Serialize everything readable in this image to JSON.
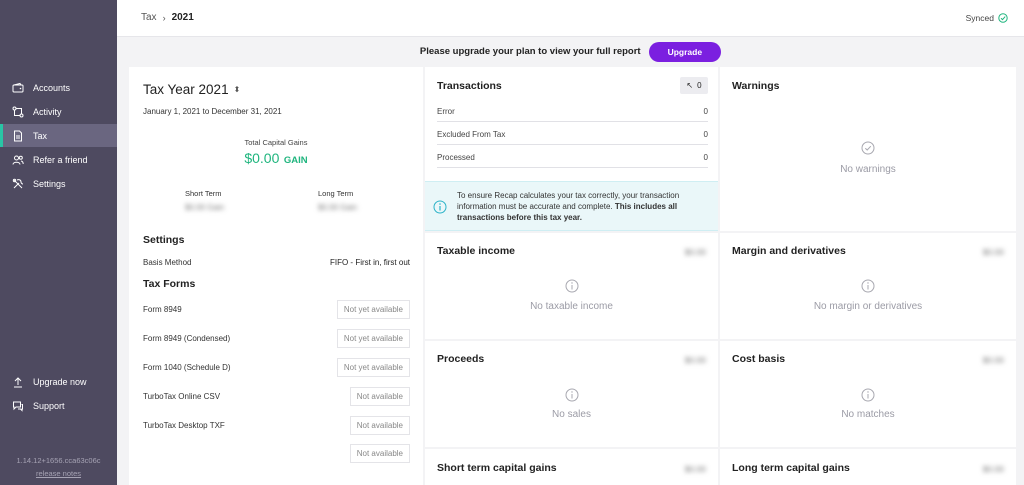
{
  "sidebar": {
    "items": [
      {
        "label": "Accounts",
        "icon": "wallet-icon"
      },
      {
        "label": "Activity",
        "icon": "activity-icon"
      },
      {
        "label": "Tax",
        "icon": "document-icon"
      },
      {
        "label": "Refer a friend",
        "icon": "users-icon"
      },
      {
        "label": "Settings",
        "icon": "tools-icon"
      }
    ],
    "bottom": [
      {
        "label": "Upgrade now",
        "icon": "upgrade-icon"
      },
      {
        "label": "Support",
        "icon": "chat-icon"
      }
    ],
    "version": "1.14.12+1656.cca63c06c",
    "release_notes": "release notes"
  },
  "header": {
    "breadcrumb_parent": "Tax",
    "breadcrumb_current": "2021",
    "sync_status": "Synced"
  },
  "banner": {
    "text": "Please upgrade your plan to view your full report",
    "button": "Upgrade",
    "button_color": "#7b1fe0"
  },
  "tax_year": {
    "title": "Tax Year 2021",
    "range": "January 1, 2021 to December 31, 2021",
    "gains_label": "Total Capital Gains",
    "gains_value": "$0.00",
    "gains_suffix": "GAIN",
    "gains_color": "#1fb57e",
    "short_term_label": "Short Term",
    "short_term_value": "$0.00 Gain",
    "long_term_label": "Long Term",
    "long_term_value": "$0.00 Gain"
  },
  "settings": {
    "title": "Settings",
    "basis_label": "Basis Method",
    "basis_value": "FIFO - First in, first out"
  },
  "tax_forms": {
    "title": "Tax Forms",
    "forms": [
      {
        "label": "Form 8949",
        "status": "Not yet available"
      },
      {
        "label": "Form 8949 (Condensed)",
        "status": "Not yet available"
      },
      {
        "label": "Form 1040 (Schedule D)",
        "status": "Not yet available"
      },
      {
        "label": "TurboTax Online CSV",
        "status": "Not available"
      },
      {
        "label": "TurboTax Desktop TXF",
        "status": "Not available"
      },
      {
        "label": "",
        "status": "Not available"
      }
    ]
  },
  "transactions": {
    "title": "Transactions",
    "badge": "0",
    "rows": [
      {
        "label": "Error",
        "value": "0"
      },
      {
        "label": "Excluded From Tax",
        "value": "0"
      },
      {
        "label": "Processed",
        "value": "0"
      }
    ],
    "info_text": "To ensure Recap calculates your tax correctly, your transaction information must be accurate and complete. ",
    "info_bold": "This includes all transactions before this tax year."
  },
  "warnings": {
    "title": "Warnings",
    "empty": "No warnings"
  },
  "cards": {
    "taxable_income": {
      "title": "Taxable income",
      "value": "$0.00",
      "empty": "No taxable income"
    },
    "margin": {
      "title": "Margin and derivatives",
      "value": "$0.00",
      "empty": "No margin or derivatives"
    },
    "proceeds": {
      "title": "Proceeds",
      "value": "$0.00",
      "empty": "No sales"
    },
    "cost_basis": {
      "title": "Cost basis",
      "value": "$0.00",
      "empty": "No matches"
    },
    "short_term": {
      "title": "Short term capital gains",
      "value": "$0.00"
    },
    "long_term": {
      "title": "Long term capital gains",
      "value": "$0.00"
    }
  }
}
